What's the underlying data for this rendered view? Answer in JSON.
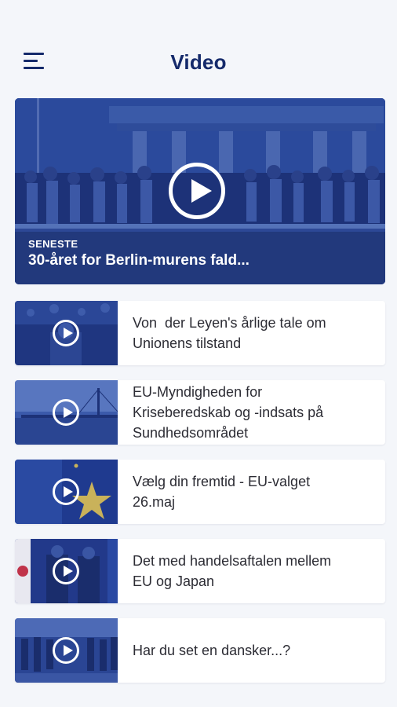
{
  "header": {
    "title": "Video",
    "menu_icon": "hamburger-menu-icon"
  },
  "hero": {
    "tag": "SENESTE",
    "caption": "30-året for Berlin-murens fald...",
    "play_icon": "play-icon"
  },
  "videos": [
    {
      "title": "Von  der Leyen's årlige tale om\nUnionens tilstand"
    },
    {
      "title": "EU-Myndigheden for\nKriseberedskab og -indsats på\nSundhedsområdet"
    },
    {
      "title": "Vælg din fremtid - EU-valget\n26.maj"
    },
    {
      "title": "Det med handelsaftalen mellem\nEU og Japan"
    },
    {
      "title": "Har du set en dansker...?"
    }
  ],
  "colors": {
    "brand_navy": "#152a6b",
    "thumbnail_tint": "#24408f",
    "background": "#f4f6fa",
    "card": "#ffffff"
  }
}
